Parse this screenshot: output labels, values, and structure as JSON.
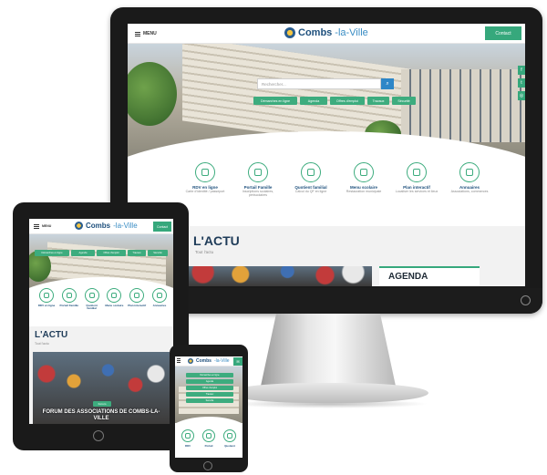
{
  "site": {
    "logo_main": "Combs",
    "logo_rest": "-la-Ville",
    "menu_label": "MENU",
    "contact_label": "Contact",
    "search_placeholder": "Rechercher...",
    "quick_chips": [
      "Démarches en ligne",
      "Agenda",
      "Offres d'emploi",
      "Travaux",
      "Sécurité"
    ],
    "services": [
      {
        "title": "RDV en ligne",
        "sub": "Carte d'identité / passeport",
        "icon": "calendar-icon"
      },
      {
        "title": "Portail Famille",
        "sub": "Inscriptions scolaires, périscolaires",
        "icon": "family-icon"
      },
      {
        "title": "Quotient familial",
        "sub": "Calcul du QF en ligne",
        "icon": "calculator-icon"
      },
      {
        "title": "Menu scolaire",
        "sub": "Restauration municipale",
        "icon": "cutlery-icon"
      },
      {
        "title": "Plan interactif",
        "sub": "Localiser les services et lieux",
        "icon": "map-icon"
      },
      {
        "title": "Annuaires",
        "sub": "Associations, commerces",
        "icon": "book-icon"
      }
    ],
    "news_title": "L'ACTU",
    "news_sub": "Tout l'actu",
    "agenda_title": "AGENDA",
    "tablet_event_title": "FORUM DES ASSOCIATIONS DE COMBS-LA-VILLE",
    "tablet_event_tag": "Forum",
    "tablet_service_titles": [
      "RDV en ligne",
      "Portail Famille",
      "Quotient familial",
      "Menu scolaire",
      "Plan interactif",
      "Annuaires"
    ],
    "phone_service_titles": [
      "RDV",
      "Portail",
      "Quotient"
    ]
  },
  "colors": {
    "accent": "#36a87c",
    "brand": "#1d4f7c",
    "link": "#2d86c7"
  }
}
